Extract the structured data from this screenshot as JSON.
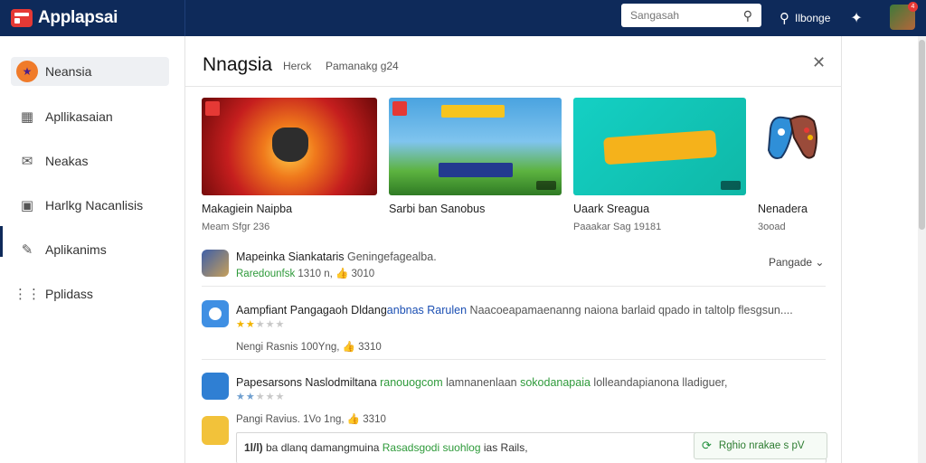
{
  "app": {
    "title": "Applapsai"
  },
  "search": {
    "placeholder": "Sangasah"
  },
  "topbar": {
    "user_label": "Ilbonge"
  },
  "sidebar": {
    "items": [
      {
        "label": "Neansia",
        "icon": "badge-icon",
        "active": true
      },
      {
        "label": "Apllikasaian",
        "icon": "grid-icon"
      },
      {
        "label": "Neakas",
        "icon": "mail-icon"
      },
      {
        "label": "Harlkg Nacanlisis",
        "icon": "briefcase-icon",
        "selected": true
      },
      {
        "label": "Aplikanims",
        "icon": "pen-icon"
      },
      {
        "label": "Pplidass",
        "icon": "dots-icon"
      }
    ]
  },
  "main": {
    "title": "Nnagsia",
    "tab_1": "Herck",
    "tab_2": "Pamanakg g24",
    "featured": [
      {
        "title": "Makagiein Naipba",
        "sub": "Meam  Sfgr 236"
      },
      {
        "title": "Sarbi ban Sanobus",
        "sub": ""
      },
      {
        "title": "Uaark Sreagua",
        "sub": "Paaakar  Sag 19181"
      },
      {
        "title": "Nenadera",
        "sub": "3ooad"
      }
    ],
    "rows": [
      {
        "title": "Mapeinka  Siankataris",
        "title_extra": "  Geningefagealba.",
        "meta_green": "Raredounfsk",
        "meta": "  1310 n,",
        "meta_like": "  3010",
        "dropdown": "Pangade"
      },
      {
        "title": "Aampfiant Pangagaoh Dldang",
        "title_blue": "anbnas Rarulen",
        "title_rest": " Naacoeapamaenanng naiona  barlaid qpado in taltolp flesgsun....",
        "stars_on": 2,
        "stars_total": 5,
        "meta": "Nengi Rasnis 100Yng,",
        "meta_like": "  3310"
      },
      {
        "title": "Papesarsons Naslodmiltana",
        "title_green": "  ranouogcom",
        "title_rest": "  lamnanenlaan ",
        "title_green2": "sokodanapaia",
        "title_rest2": " lolleandapianona lladiguer,",
        "stars_on": 2,
        "stars_total": 5,
        "meta": "Pangi Ravius. 1Vo 1ng,",
        "meta_like": "  3310"
      }
    ],
    "bottom": {
      "lead": "1l/l)",
      "text": "  ba dlanq damangmuina  ",
      "green": "Rasadsgodi  suohlog",
      "text2": " ias Rails,"
    },
    "action_button": "Rghio nrakae  s  pV"
  }
}
